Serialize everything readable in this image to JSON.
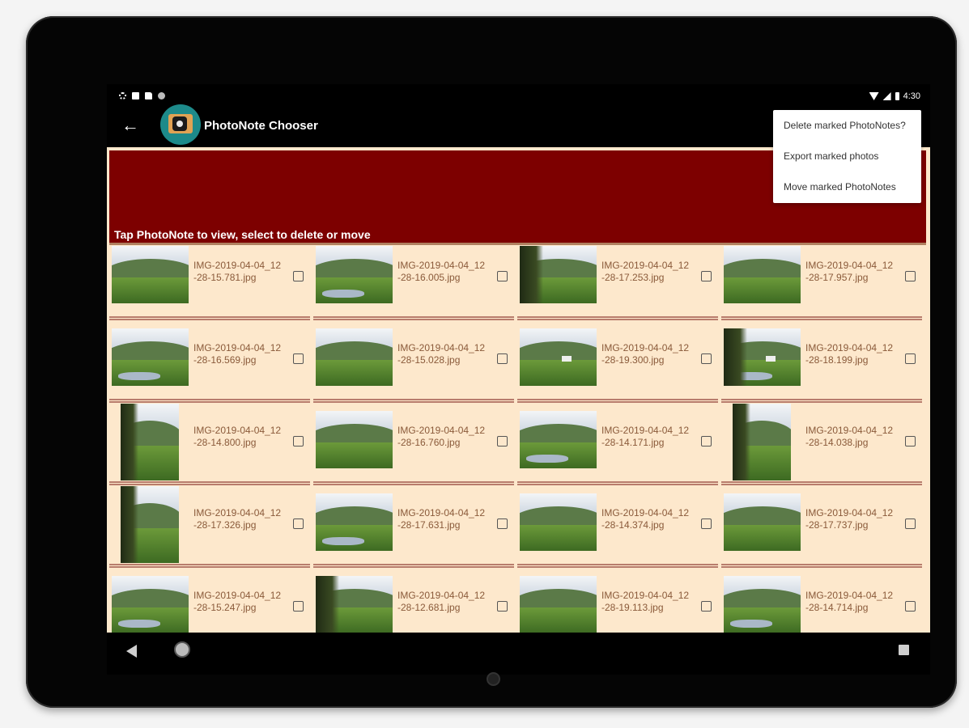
{
  "status": {
    "time": "4:30"
  },
  "appbar": {
    "title": "PhotoNote Chooser"
  },
  "banner": {
    "text": "Tap PhotoNote to view, select to delete or move"
  },
  "menu": {
    "items": [
      {
        "label": "Delete marked PhotoNotes?"
      },
      {
        "label": "Export marked photos"
      },
      {
        "label": "Move marked PhotoNotes"
      }
    ]
  },
  "photos": [
    {
      "file": "IMG-2019-04-04_12-28-15.781.jpg",
      "portrait": false,
      "checked": false
    },
    {
      "file": "IMG-2019-04-04_12-28-16.005.jpg",
      "portrait": false,
      "checked": false
    },
    {
      "file": "IMG-2019-04-04_12-28-17.253.jpg",
      "portrait": false,
      "checked": false
    },
    {
      "file": "IMG-2019-04-04_12-28-17.957.jpg",
      "portrait": false,
      "checked": false
    },
    {
      "file": "IMG-2019-04-04_12-28-16.569.jpg",
      "portrait": false,
      "checked": false
    },
    {
      "file": "IMG-2019-04-04_12-28-15.028.jpg",
      "portrait": false,
      "checked": false
    },
    {
      "file": "IMG-2019-04-04_12-28-19.300.jpg",
      "portrait": false,
      "checked": false
    },
    {
      "file": "IMG-2019-04-04_12-28-18.199.jpg",
      "portrait": false,
      "checked": false
    },
    {
      "file": "IMG-2019-04-04_12-28-14.800.jpg",
      "portrait": true,
      "checked": false
    },
    {
      "file": "IMG-2019-04-04_12-28-16.760.jpg",
      "portrait": false,
      "checked": false
    },
    {
      "file": "IMG-2019-04-04_12-28-14.171.jpg",
      "portrait": false,
      "checked": false
    },
    {
      "file": "IMG-2019-04-04_12-28-14.038.jpg",
      "portrait": true,
      "checked": false
    },
    {
      "file": "IMG-2019-04-04_12-28-17.326.jpg",
      "portrait": true,
      "checked": false
    },
    {
      "file": "IMG-2019-04-04_12-28-17.631.jpg",
      "portrait": false,
      "checked": false
    },
    {
      "file": "IMG-2019-04-04_12-28-14.374.jpg",
      "portrait": false,
      "checked": false
    },
    {
      "file": "IMG-2019-04-04_12-28-17.737.jpg",
      "portrait": false,
      "checked": false
    },
    {
      "file": "IMG-2019-04-04_12-28-15.247.jpg",
      "portrait": false,
      "checked": false
    },
    {
      "file": "IMG-2019-04-04_12-28-12.681.jpg",
      "portrait": false,
      "checked": false
    },
    {
      "file": "IMG-2019-04-04_12-28-19.113.jpg",
      "portrait": false,
      "checked": false
    },
    {
      "file": "IMG-2019-04-04_12-28-14.714.jpg",
      "portrait": false,
      "checked": false
    }
  ]
}
